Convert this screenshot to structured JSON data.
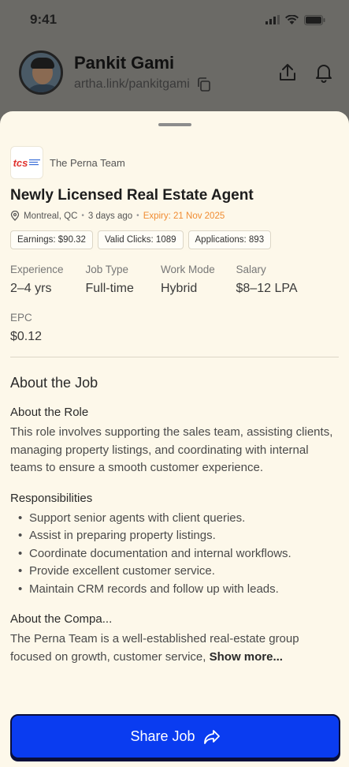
{
  "status_bar": {
    "time": "9:41"
  },
  "profile": {
    "name": "Pankit Gami",
    "link": "artha.link/pankitgami"
  },
  "job": {
    "company_name": "The Perna Team",
    "logo_text": "tcs",
    "title": "Newly Licensed Real Estate Agent",
    "location": "Montreal, QC",
    "posted": "3 days ago",
    "expiry": "Expiry: 21 Nov 2025",
    "stats": [
      {
        "label": "Earnings: $90.32"
      },
      {
        "label": "Valid Clicks: 1089"
      },
      {
        "label": "Applications: 893"
      }
    ],
    "details": [
      {
        "label": "Experience",
        "value": "2–4 yrs"
      },
      {
        "label": "Job Type",
        "value": "Full-time"
      },
      {
        "label": "Work Mode",
        "value": "Hybrid"
      },
      {
        "label": "Salary",
        "value": "$8–12 LPA"
      }
    ],
    "epc": {
      "label": "EPC",
      "value": "$0.12"
    }
  },
  "about": {
    "section_title": "About the Job",
    "role_title": "About the Role",
    "role_text": "This role involves supporting the sales team, assisting clients, managing property listings, and coordinating with internal teams to ensure a smooth customer experience.",
    "responsibilities_title": "Responsibilities",
    "responsibilities": [
      "Support senior agents with client queries.",
      "Assist in preparing property listings.",
      "Coordinate documentation and internal workflows.",
      "Provide excellent customer service.",
      "Maintain CRM records and follow up with leads."
    ],
    "company_title": "About the Compa...",
    "company_text": "The Perna Team is a well-established real-estate group focused on growth, customer service,",
    "show_more": "Show more..."
  },
  "share_button": {
    "label": "Share Job"
  },
  "colors": {
    "accent": "#0a3cf0",
    "sheet_bg": "#fdf8ea",
    "expiry": "#f08c32"
  }
}
